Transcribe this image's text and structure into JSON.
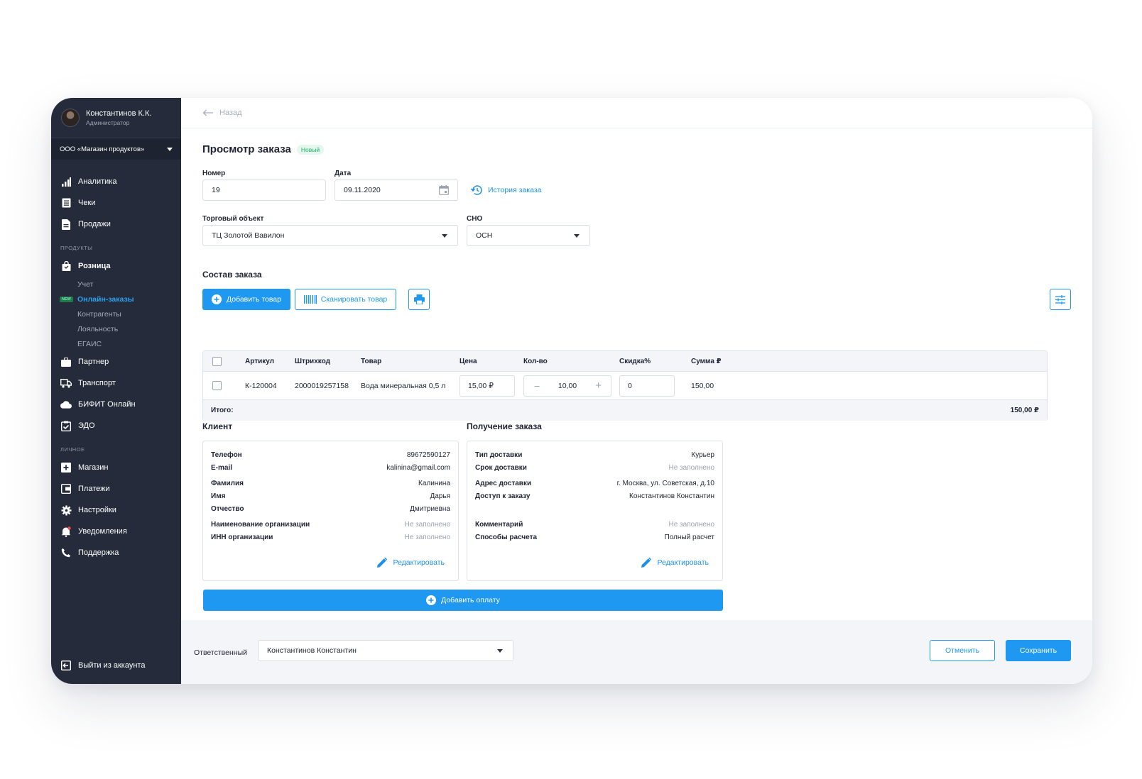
{
  "user": {
    "name": "Константинов К.К.",
    "role": "Администратор"
  },
  "org": "ООО «Магазин продуктов»",
  "sidebar": {
    "top_items": [
      {
        "label": "Аналитика",
        "icon": "chart-icon"
      },
      {
        "label": "Чеки",
        "icon": "receipt-icon"
      },
      {
        "label": "Продажи",
        "icon": "document-icon"
      }
    ],
    "section_products": "ПРОДУКТЫ",
    "retail": "Розница",
    "retail_sub": [
      "Учет",
      "Онлайн-заказы",
      "Контрагенты",
      "Лояльность",
      "ЕГАИС"
    ],
    "new_tag": "NEW",
    "product_items": [
      {
        "label": "Партнер",
        "icon": "briefcase-icon"
      },
      {
        "label": "Транспорт",
        "icon": "truck-icon"
      },
      {
        "label": "БИФИТ Онлайн",
        "icon": "cloud-icon"
      },
      {
        "label": "ЭДО",
        "icon": "clipboard-check-icon"
      }
    ],
    "section_personal": "ЛИЧНОЕ",
    "personal_items": [
      {
        "label": "Магазин",
        "icon": "store-icon"
      },
      {
        "label": "Платежи",
        "icon": "wallet-icon"
      },
      {
        "label": "Настройки",
        "icon": "gear-icon"
      },
      {
        "label": "Уведомления",
        "icon": "bell-icon"
      },
      {
        "label": "Поддержка",
        "icon": "phone-icon"
      }
    ],
    "logout": "Выйти из аккаунта"
  },
  "topbar": {
    "back": "Назад"
  },
  "page": {
    "title": "Просмотр заказа",
    "status": "Новый"
  },
  "form": {
    "number_label": "Номер",
    "number_value": "19",
    "date_label": "Дата",
    "date_value": "09.11.2020",
    "history_link": "История заказа",
    "store_label": "Торговый объект",
    "store_value": "ТЦ Золотой Вавилон",
    "sno_label": "СНО",
    "sno_value": "ОСН"
  },
  "order": {
    "title": "Состав заказа",
    "add_button": "Добавить товар",
    "scan_button": "Сканировать товар",
    "columns": [
      "Артикул",
      "Штрихкод",
      "Товар",
      "Цена",
      "Кол-во",
      "Скидка%",
      "Сумма ₽"
    ],
    "rows": [
      {
        "sku": "К-120004",
        "barcode": "2000019257158",
        "name": "Вода минеральная 0,5 л",
        "price": "15,00 ₽",
        "qty": "10,00",
        "discount": "0",
        "sum": "150,00"
      }
    ],
    "total_label": "Итого:",
    "total_value": "150,00 ₽"
  },
  "client": {
    "title": "Клиент",
    "phone_k": "Телефон",
    "phone_v": "89672590127",
    "email_k": "E-mail",
    "email_v": "kalinina@gmail.com",
    "last_k": "Фамилия",
    "last_v": "Калинина",
    "first_k": "Имя",
    "first_v": "Дарья",
    "middle_k": "Отчество",
    "middle_v": "Дмитриевна",
    "orgname_k": "Наименование организации",
    "orgname_v": "Не заполнено",
    "inn_k": "ИНН организации",
    "inn_v": "Не заполнено",
    "edit": "Редактировать"
  },
  "delivery": {
    "title": "Получение заказа",
    "type_k": "Тип доставки",
    "type_v": "Курьер",
    "term_k": "Срок доставки",
    "term_v": "Не заполнено",
    "addr_k": "Адрес доставки",
    "addr_v": "г. Москва, ул. Советская, д.10",
    "access_k": "Доступ к заказу",
    "access_v": "Константинов Константин",
    "comment_k": "Комментарий",
    "comment_v": "Не заполнено",
    "pay_k": "Способы расчета",
    "pay_v": "Полный расчет",
    "edit": "Редактировать"
  },
  "add_payment": "Добавить оплату",
  "footer": {
    "responsible_label": "Ответственный",
    "responsible_value": "Константинов Константин",
    "cancel": "Отменить",
    "save": "Сохранить"
  },
  "colors": {
    "accent": "#1e98f0",
    "sidebar": "#252b3b",
    "success": "#21b26a"
  }
}
